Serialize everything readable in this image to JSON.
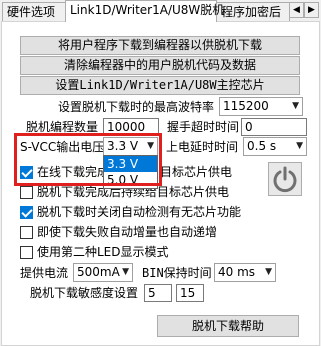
{
  "tabs": [
    "硬件选项",
    "Link1D/Writer1A/U8W脱机",
    "程序加密后"
  ],
  "tab_scroll": {
    "left": "◀",
    "right": "▶"
  },
  "buttons": {
    "download_user_program": "将用户程序下载到编程器以供脱机下载",
    "clear_programmer": "清除编程器中的用户脱机代码及数据",
    "set_master_chip": "设置Link1D/Writer1A/U8W主控芯片",
    "offline_help": "脱机下载帮助"
  },
  "baud": {
    "label": "设置脱机下载时的最高波特率",
    "value": "115200"
  },
  "program_count": {
    "label": "脱机编程数量",
    "value": "10000"
  },
  "handshake_timeout": {
    "label": "握手超时时间",
    "value": "0"
  },
  "svcc": {
    "label": "S-VCC输出电压",
    "value": "3.3 V",
    "options": [
      "3.3 V",
      "5.0 V"
    ]
  },
  "power_delay": {
    "label": "上电延时时间",
    "value": "0.5 s"
  },
  "checks": [
    {
      "label": "在线下载完成",
      "label_tail": "目标芯片供电",
      "checked": true
    },
    {
      "label": "脱机下载完成后持续给目标芯片供电",
      "checked": false
    },
    {
      "label": "脱机下载时关闭自动检测有无芯片功能",
      "checked": true
    },
    {
      "label": "即使下载失败自动增量也自动递增",
      "checked": false
    },
    {
      "label": "使用第二种LED显示模式",
      "checked": false
    }
  ],
  "supply_current": {
    "label": "提供电流",
    "value": "500mA"
  },
  "bin_hold": {
    "label": "BIN保持时间",
    "value": "40 ms"
  },
  "sensitivity": {
    "label": "脱机下载敏感度设置",
    "value1": "5",
    "value2": "15"
  },
  "icons": {
    "power": "power-icon",
    "dropdown": "chevron-down-icon"
  },
  "colors": {
    "highlight_box": "#e0201f",
    "selection": "#0078d7"
  }
}
